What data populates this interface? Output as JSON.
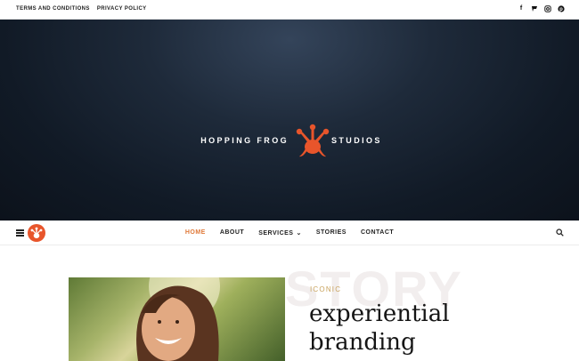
{
  "topbar": {
    "links": [
      "TERMS AND CONDITIONS",
      "PRIVACY POLICY"
    ],
    "social_icons": [
      "facebook-icon",
      "foursquare-icon",
      "instagram-icon",
      "pinterest-icon"
    ]
  },
  "hero": {
    "brand_left": "HOPPING FROG",
    "brand_right": "STUDIOS",
    "logo_icon": "frog-foot-icon",
    "logo_color": "#e8552b"
  },
  "nav": {
    "items": [
      "HOME",
      "ABOUT",
      "SERVICES",
      "STORIES",
      "CONTACT"
    ],
    "active": "HOME",
    "active_color": "#e07a3a",
    "search_icon": "search-icon",
    "menu_icon": "hamburger-icon"
  },
  "content": {
    "ghost_text": "STORY",
    "eyebrow": "ICONIC",
    "headline_line1": "experiential",
    "headline_line2": "branding"
  }
}
